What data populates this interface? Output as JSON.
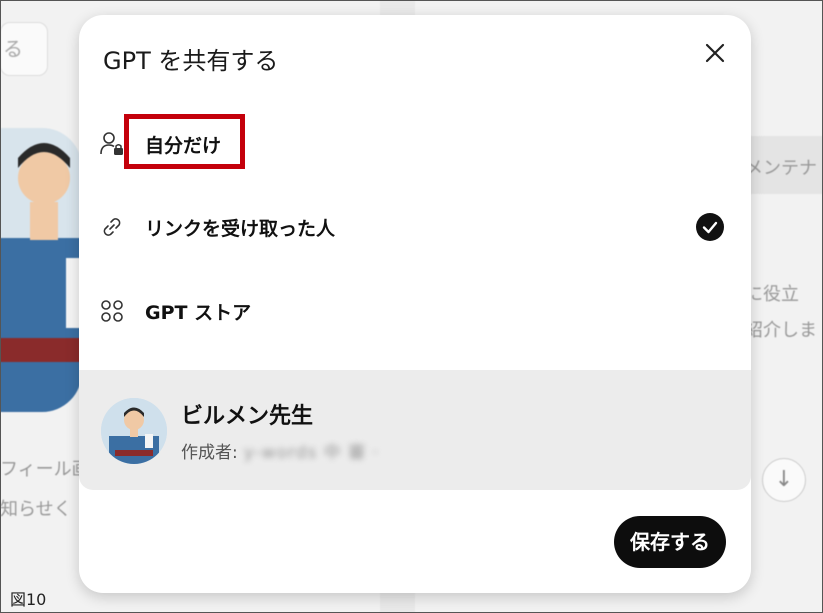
{
  "modal": {
    "title": "GPT を共有する",
    "close_icon": "close-icon",
    "options": [
      {
        "label": "自分だけ",
        "icon": "person-lock-icon",
        "selected": false,
        "highlighted": true
      },
      {
        "label": "リンクを受け取った人",
        "icon": "link-icon",
        "selected": true
      },
      {
        "label": "GPT ストア",
        "icon": "grid-icon",
        "selected": false
      }
    ],
    "gpt": {
      "name": "ビルメン先生",
      "author_label": "作成者:",
      "author_value": "y-words  中 審 ·"
    },
    "save_label": "保存する"
  },
  "background": {
    "left_pill": "る",
    "profile_line1": "フィール画",
    "profile_line2": "知らせく",
    "right_line1": "メンテナ",
    "right_line2": "に役立",
    "right_line3": "紹介しま"
  },
  "caption": "図10",
  "colors": {
    "highlight": "#c4000b",
    "save_bg": "#0d0d0d",
    "check_bg": "#111111"
  }
}
